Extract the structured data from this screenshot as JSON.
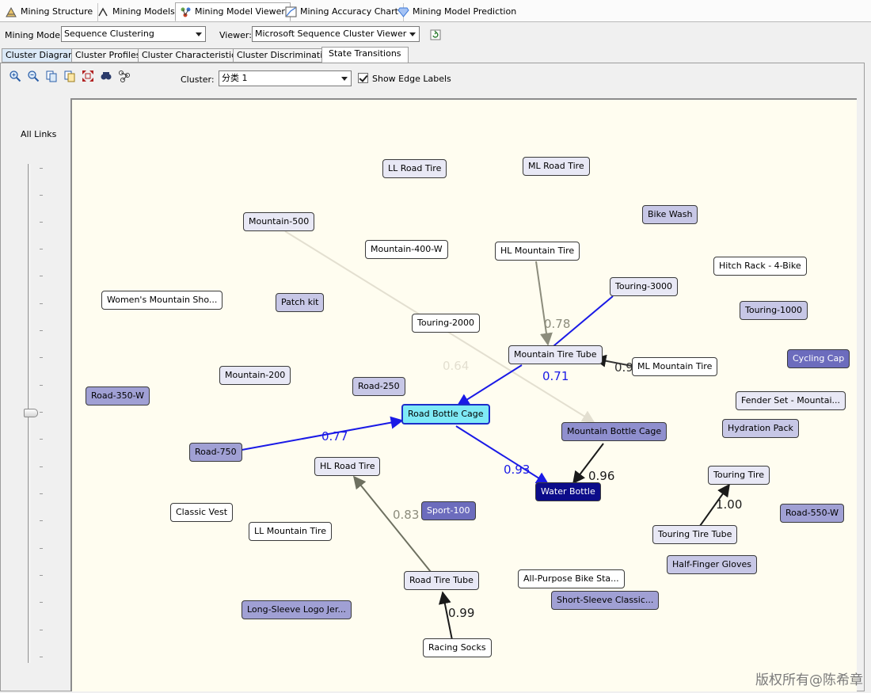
{
  "top_tabs": [
    {
      "label": "Mining Structure",
      "icon": "mining-structure-icon"
    },
    {
      "label": "Mining Models",
      "icon": "mining-models-icon"
    },
    {
      "label": "Mining Model Viewer",
      "icon": "mining-model-viewer-icon"
    },
    {
      "label": "Mining Accuracy Chart",
      "icon": "accuracy-chart-icon"
    },
    {
      "label": "Mining Model Prediction",
      "icon": "prediction-diamond-icon"
    }
  ],
  "toolbar": {
    "mining_model_label": "Mining Model:",
    "mining_model_value": "Sequence Clustering",
    "viewer_label": "Viewer:",
    "viewer_value": "Microsoft Sequence Cluster Viewer"
  },
  "sub_tabs": [
    "Cluster Diagram",
    "Cluster Profiles",
    "Cluster Characteristics",
    "Cluster Discrimination",
    "State Transitions"
  ],
  "viewer_toolbar": {
    "cluster_label": "Cluster:",
    "cluster_value": "分类 1",
    "show_edge_labels": "Show Edge Labels",
    "show_edge_labels_checked": true
  },
  "slider": {
    "label": "All Links"
  },
  "nodes": {
    "ll_road_tire": "LL Road Tire",
    "ml_road_tire": "ML Road Tire",
    "bike_wash": "Bike Wash",
    "mountain_500": "Mountain-500",
    "mountain_400_w": "Mountain-400-W",
    "hl_mountain_tire": "HL Mountain Tire",
    "hitch_rack": "Hitch Rack - 4-Bike",
    "touring_3000": "Touring-3000",
    "womens_mountain": "Women's Mountain Sho...",
    "patch_kit": "Patch kit",
    "touring_1000": "Touring-1000",
    "touring_2000": "Touring-2000",
    "mountain_tire_tube": "Mountain Tire Tube",
    "ml_mountain_tire": "ML Mountain Tire",
    "cycling_cap": "Cycling Cap",
    "mountain_200": "Mountain-200",
    "road_250": "Road-250",
    "road_350_w": "Road-350-W",
    "fender_set": "Fender Set - Mountai...",
    "road_bottle_cage": "Road Bottle Cage",
    "hydration_pack": "Hydration Pack",
    "mountain_bottle_cage": "Mountain Bottle Cage",
    "road_750": "Road-750",
    "hl_road_tire": "HL Road Tire",
    "touring_tire": "Touring Tire",
    "water_bottle": "Water Bottle",
    "classic_vest": "Classic Vest",
    "sport_100": "Sport-100",
    "road_550_w": "Road-550-W",
    "ll_mountain_tire": "LL Mountain Tire",
    "touring_tire_tube": "Touring Tire Tube",
    "half_finger_gloves": "Half-Finger Gloves",
    "all_purpose": "All-Purpose Bike Sta...",
    "road_tire_tube": "Road Tire Tube",
    "long_sleeve": "Long-Sleeve Logo Jer...",
    "short_sleeve": "Short-Sleeve Classic...",
    "racing_socks": "Racing Socks"
  },
  "edges": {
    "hl_mountain_to_tube": "0.78",
    "touring3000_to_tube": "0.71",
    "ml_mountain_to_tube": "0.9",
    "mountain500_to_bottlecage": "0.64",
    "tube_to_roadbottle": "",
    "road750_to_roadbottle": "0.77",
    "roadbottle_to_water": "0.93",
    "mountainbottle_to_water": "0.96",
    "roadtiretube_to_hlroad": "0.83",
    "racingsocks_to_roadtiretube": "0.99",
    "touringtube_to_touringtire": "1.00"
  },
  "colors": {
    "highlight_edge": "#1a1ae6",
    "dark_edge": "#1a1a1a",
    "gray_edge": "#8c8c7c",
    "faint_edge": "#e3dfd0",
    "canvas_bg": "#fffdf0",
    "selected_node": "#7feaf6"
  },
  "watermark": "版权所有@陈希章"
}
